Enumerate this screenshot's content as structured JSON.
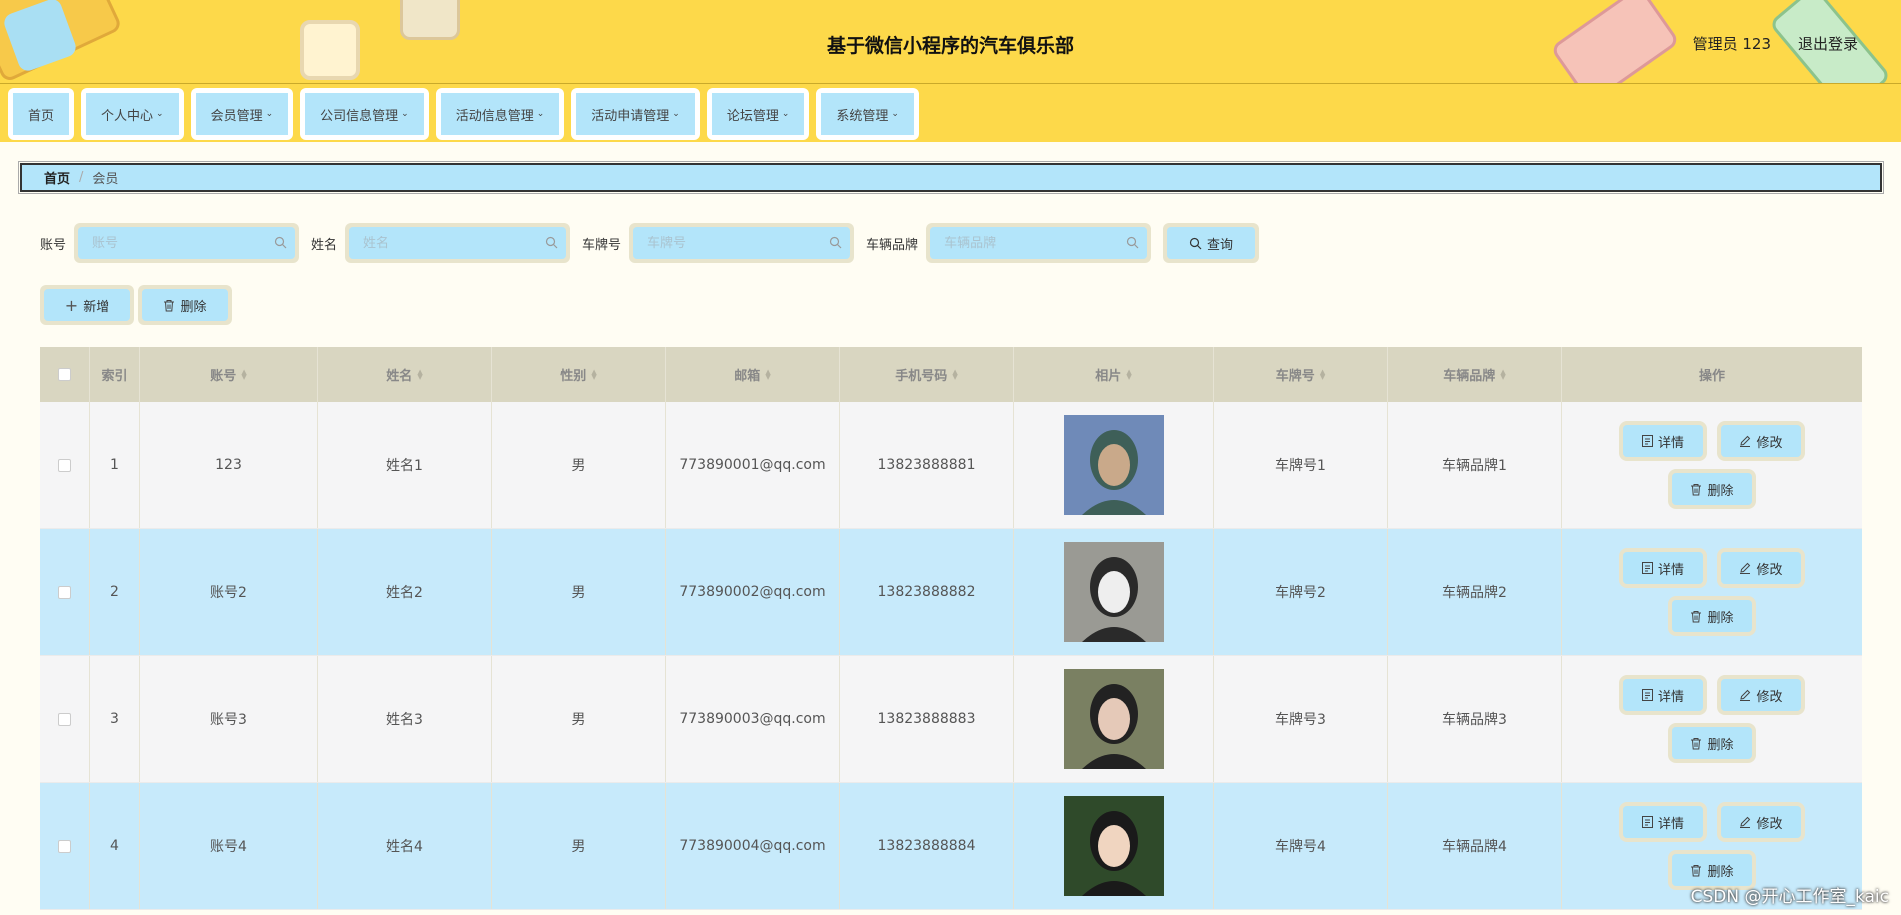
{
  "header": {
    "title": "基于微信小程序的汽车俱乐部",
    "user": "管理员 123",
    "logout": "退出登录"
  },
  "nav": [
    {
      "label": "首页",
      "dropdown": false
    },
    {
      "label": "个人中心",
      "dropdown": true
    },
    {
      "label": "会员管理",
      "dropdown": true
    },
    {
      "label": "公司信息管理",
      "dropdown": true
    },
    {
      "label": "活动信息管理",
      "dropdown": true
    },
    {
      "label": "活动申请管理",
      "dropdown": true
    },
    {
      "label": "论坛管理",
      "dropdown": true
    },
    {
      "label": "系统管理",
      "dropdown": true
    }
  ],
  "breadcrumb": {
    "home": "首页",
    "separator": "/",
    "current": "会员"
  },
  "search": {
    "account_label": "账号",
    "account_placeholder": "账号",
    "name_label": "姓名",
    "name_placeholder": "姓名",
    "plate_label": "车牌号",
    "plate_placeholder": "车牌号",
    "brand_label": "车辆品牌",
    "brand_placeholder": "车辆品牌",
    "query": "查询"
  },
  "ops": {
    "add": "新增",
    "delete": "删除"
  },
  "table": {
    "headers": [
      "索引",
      "账号",
      "姓名",
      "性别",
      "邮箱",
      "手机号码",
      "相片",
      "车牌号",
      "车辆品牌",
      "操作"
    ],
    "rows": [
      {
        "index": "1",
        "account": "123",
        "name": "姓名1",
        "gender": "男",
        "email": "773890001@qq.com",
        "phone": "13823888881",
        "plate": "车牌号1",
        "brand": "车辆品牌1"
      },
      {
        "index": "2",
        "account": "账号2",
        "name": "姓名2",
        "gender": "男",
        "email": "773890002@qq.com",
        "phone": "13823888882",
        "plate": "车牌号2",
        "brand": "车辆品牌2"
      },
      {
        "index": "3",
        "account": "账号3",
        "name": "姓名3",
        "gender": "男",
        "email": "773890003@qq.com",
        "phone": "13823888883",
        "plate": "车牌号3",
        "brand": "车辆品牌3"
      },
      {
        "index": "4",
        "account": "账号4",
        "name": "姓名4",
        "gender": "男",
        "email": "773890004@qq.com",
        "phone": "13823888884",
        "plate": "车牌号4",
        "brand": "车辆品牌4"
      }
    ],
    "actions": {
      "detail": "详情",
      "edit": "修改",
      "delete": "删除"
    }
  },
  "watermark": "CSDN @开心工作室_kaic",
  "colors": {
    "header_bg": "#fdd94a",
    "accent": "#b3e5fa",
    "row_alt": "#c7eafb"
  }
}
